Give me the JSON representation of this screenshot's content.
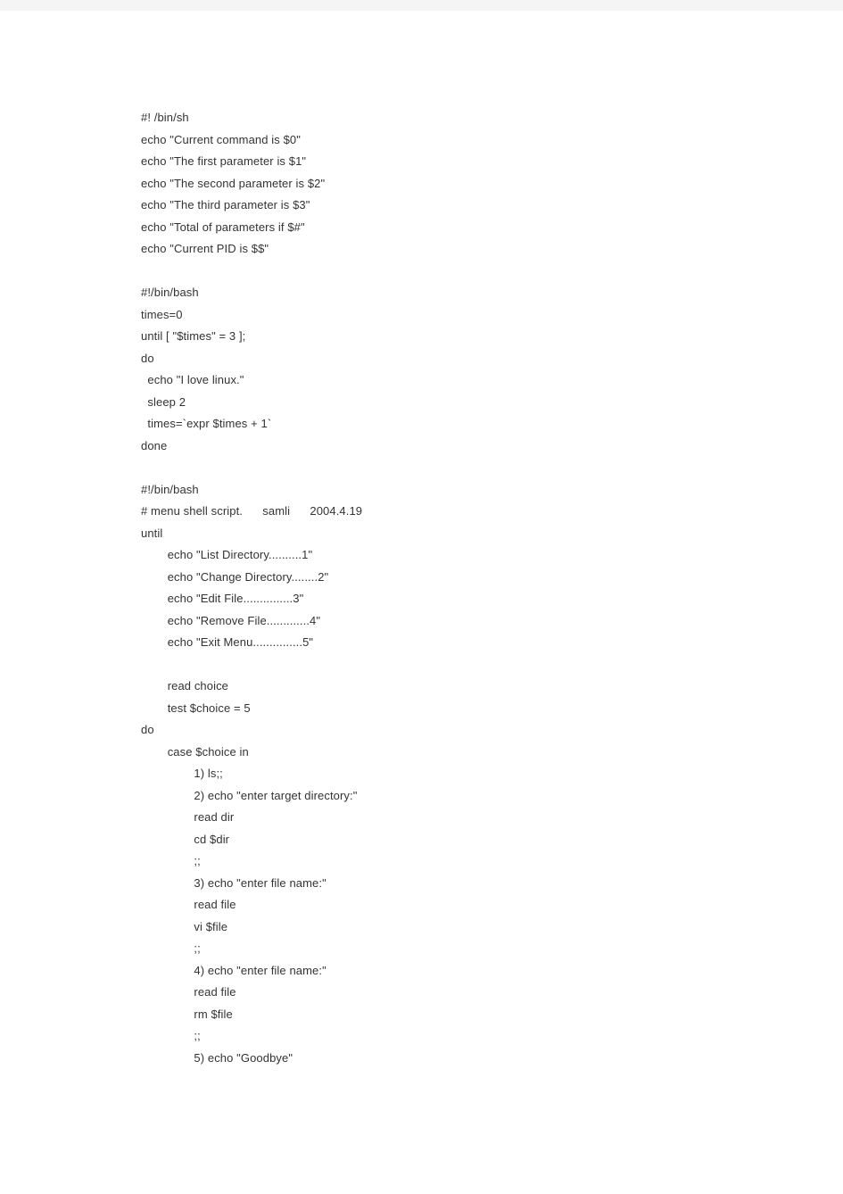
{
  "code_lines": [
    "#! /bin/sh",
    "echo \"Current command is $0\"",
    "echo \"The first parameter is $1\"",
    "echo \"The second parameter is $2\"",
    "echo \"The third parameter is $3\"",
    "echo \"Total of parameters if $#\"",
    "echo \"Current PID is $$\"",
    "",
    "#!/bin/bash",
    "times=0",
    "until [ \"$times\" = 3 ];",
    "do",
    "  echo \"I love linux.\"",
    "  sleep 2",
    "  times=`expr $times + 1`",
    "done",
    "",
    "#!/bin/bash",
    "# menu shell script.      samli      2004.4.19",
    "until",
    "        echo \"List Directory..........1\"",
    "        echo \"Change Directory........2\"",
    "        echo \"Edit File...............3\"",
    "        echo \"Remove File.............4\"",
    "        echo \"Exit Menu...............5\"",
    "",
    "        read choice",
    "        test $choice = 5",
    "do",
    "        case $choice in",
    "                1) ls;;",
    "                2) echo \"enter target directory:\"",
    "                read dir",
    "                cd $dir",
    "                ;;",
    "                3) echo \"enter file name:\"",
    "                read file",
    "                vi $file",
    "                ;;",
    "                4) echo \"enter file name:\"",
    "                read file",
    "                rm $file",
    "                ;;",
    "                5) echo \"Goodbye\""
  ]
}
